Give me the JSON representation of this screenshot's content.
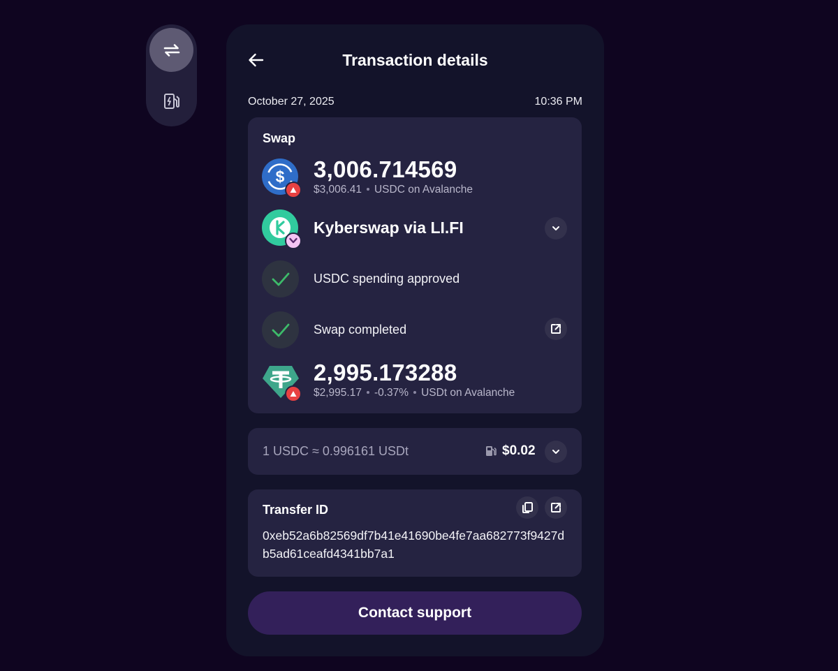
{
  "sidebar": {
    "items": [
      {
        "name": "swap",
        "icon": "swap-arrows-icon",
        "active": true
      },
      {
        "name": "gas",
        "icon": "fuel-pump-icon",
        "active": false
      }
    ]
  },
  "header": {
    "title": "Transaction details",
    "back_icon": "arrow-left-icon"
  },
  "meta": {
    "date": "October 27, 2025",
    "time": "10:36 PM"
  },
  "swap": {
    "label": "Swap",
    "from": {
      "amount": "3,006.714569",
      "usd_value": "$3,006.41",
      "token": "USDC on Avalanche",
      "icon": "usdc-icon",
      "network_icon": "avalanche-icon"
    },
    "provider": {
      "name": "Kyberswap via LI.FI",
      "icon": "kyberswap-icon",
      "badge_icon": "lifi-icon"
    },
    "steps": [
      {
        "label": "USDC spending approved",
        "status": "done"
      },
      {
        "label": "Swap completed",
        "status": "done"
      }
    ],
    "to": {
      "amount": "2,995.173288",
      "usd_value": "$2,995.17",
      "change": "-0.37%",
      "token": "USDt on Avalanche",
      "icon": "tether-icon",
      "network_icon": "avalanche-icon"
    }
  },
  "rate": {
    "text": "1 USDC ≈ 0.996161 USDt",
    "fee": "$0.02"
  },
  "transfer": {
    "label": "Transfer ID",
    "id": "0xeb52a6b82569df7b41e41690be4fe7aa682773f9427db5ad61ceafd4341bb7a1"
  },
  "actions": {
    "support_label": "Contact support"
  },
  "colors": {
    "background": "#0f0520",
    "panel": "#13132a",
    "card": "#252341",
    "accent_button": "#33205a",
    "success": "#3dbb6a",
    "usdc": "#2f6dc8",
    "tether": "#3ea68b",
    "kyber": "#31cb9e",
    "avalanche": "#e84142"
  }
}
